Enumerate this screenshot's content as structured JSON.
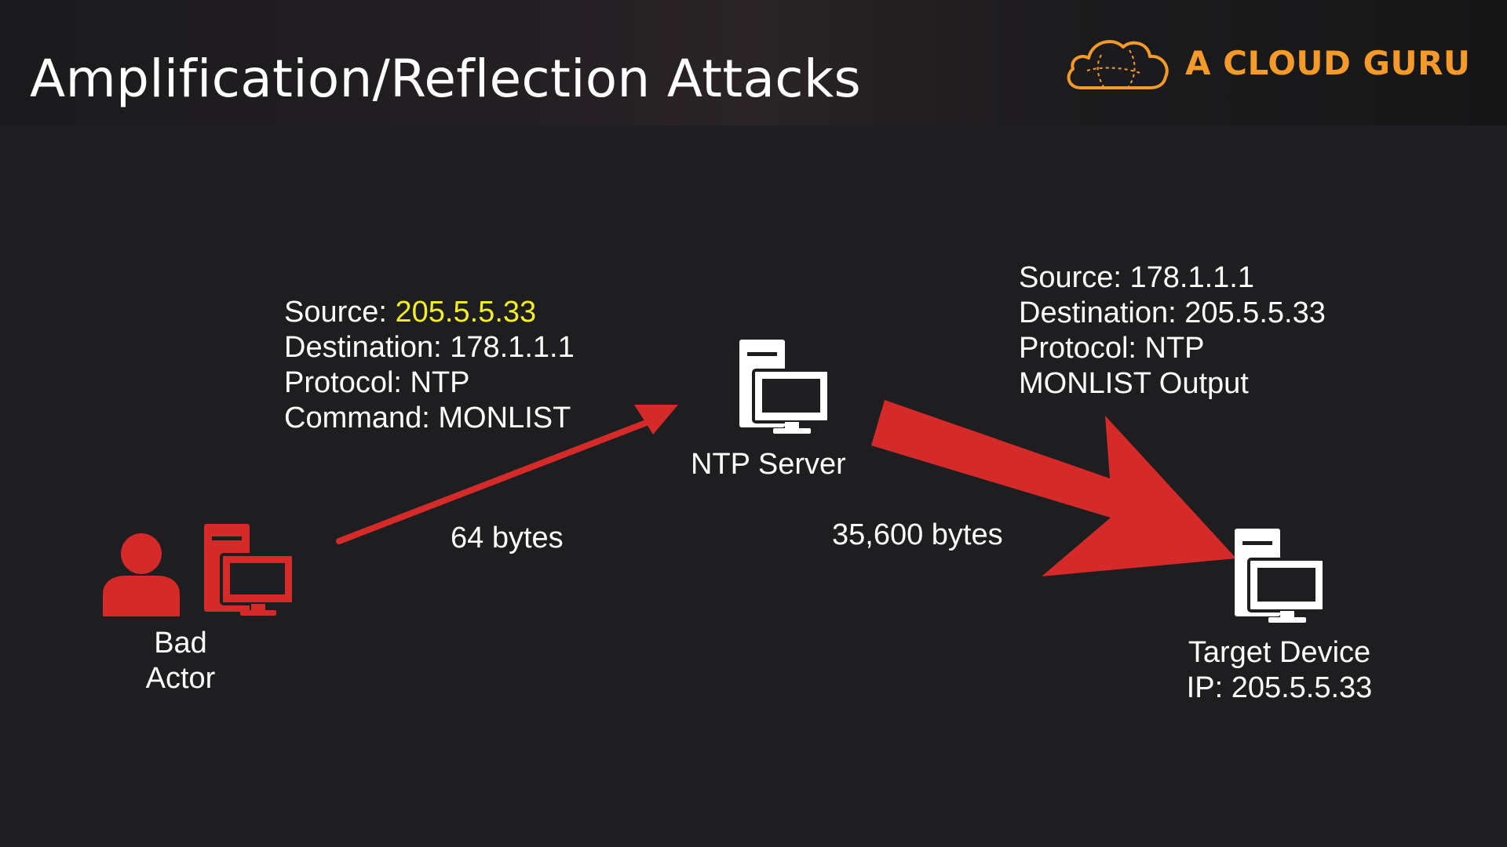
{
  "header": {
    "title": "Amplification/Reflection Attacks",
    "brand_name": "A CLOUD GURU",
    "brand_icon": "cloud-logo-icon",
    "brand_color": "#f49a2b"
  },
  "colors": {
    "background": "#1e1d1f",
    "attacker": "#d42a2a",
    "arrow": "#d42a2a",
    "highlight": "#f2ee2a",
    "text": "#ffffff"
  },
  "nodes": {
    "bad_actor": {
      "label_line1": "Bad",
      "label_line2": "Actor",
      "icons": [
        "person-icon",
        "computer-icon"
      ]
    },
    "ntp_server": {
      "label": "NTP Server",
      "icon": "server-computer-icon"
    },
    "target_device": {
      "label_line1": "Target Device",
      "label_line2": "IP: 205.5.5.33",
      "icon": "server-computer-icon"
    }
  },
  "request_packet": {
    "source_label": "Source: ",
    "source_value": "205.5.5.33",
    "destination": "Destination: 178.1.1.1",
    "protocol": "Protocol: NTP",
    "command": "Command: MONLIST",
    "size": "64 bytes"
  },
  "response_packet": {
    "source": "Source: 178.1.1.1",
    "destination": "Destination: 205.5.5.33",
    "protocol": "Protocol: NTP",
    "payload": "MONLIST Output",
    "size": "35,600 bytes"
  }
}
